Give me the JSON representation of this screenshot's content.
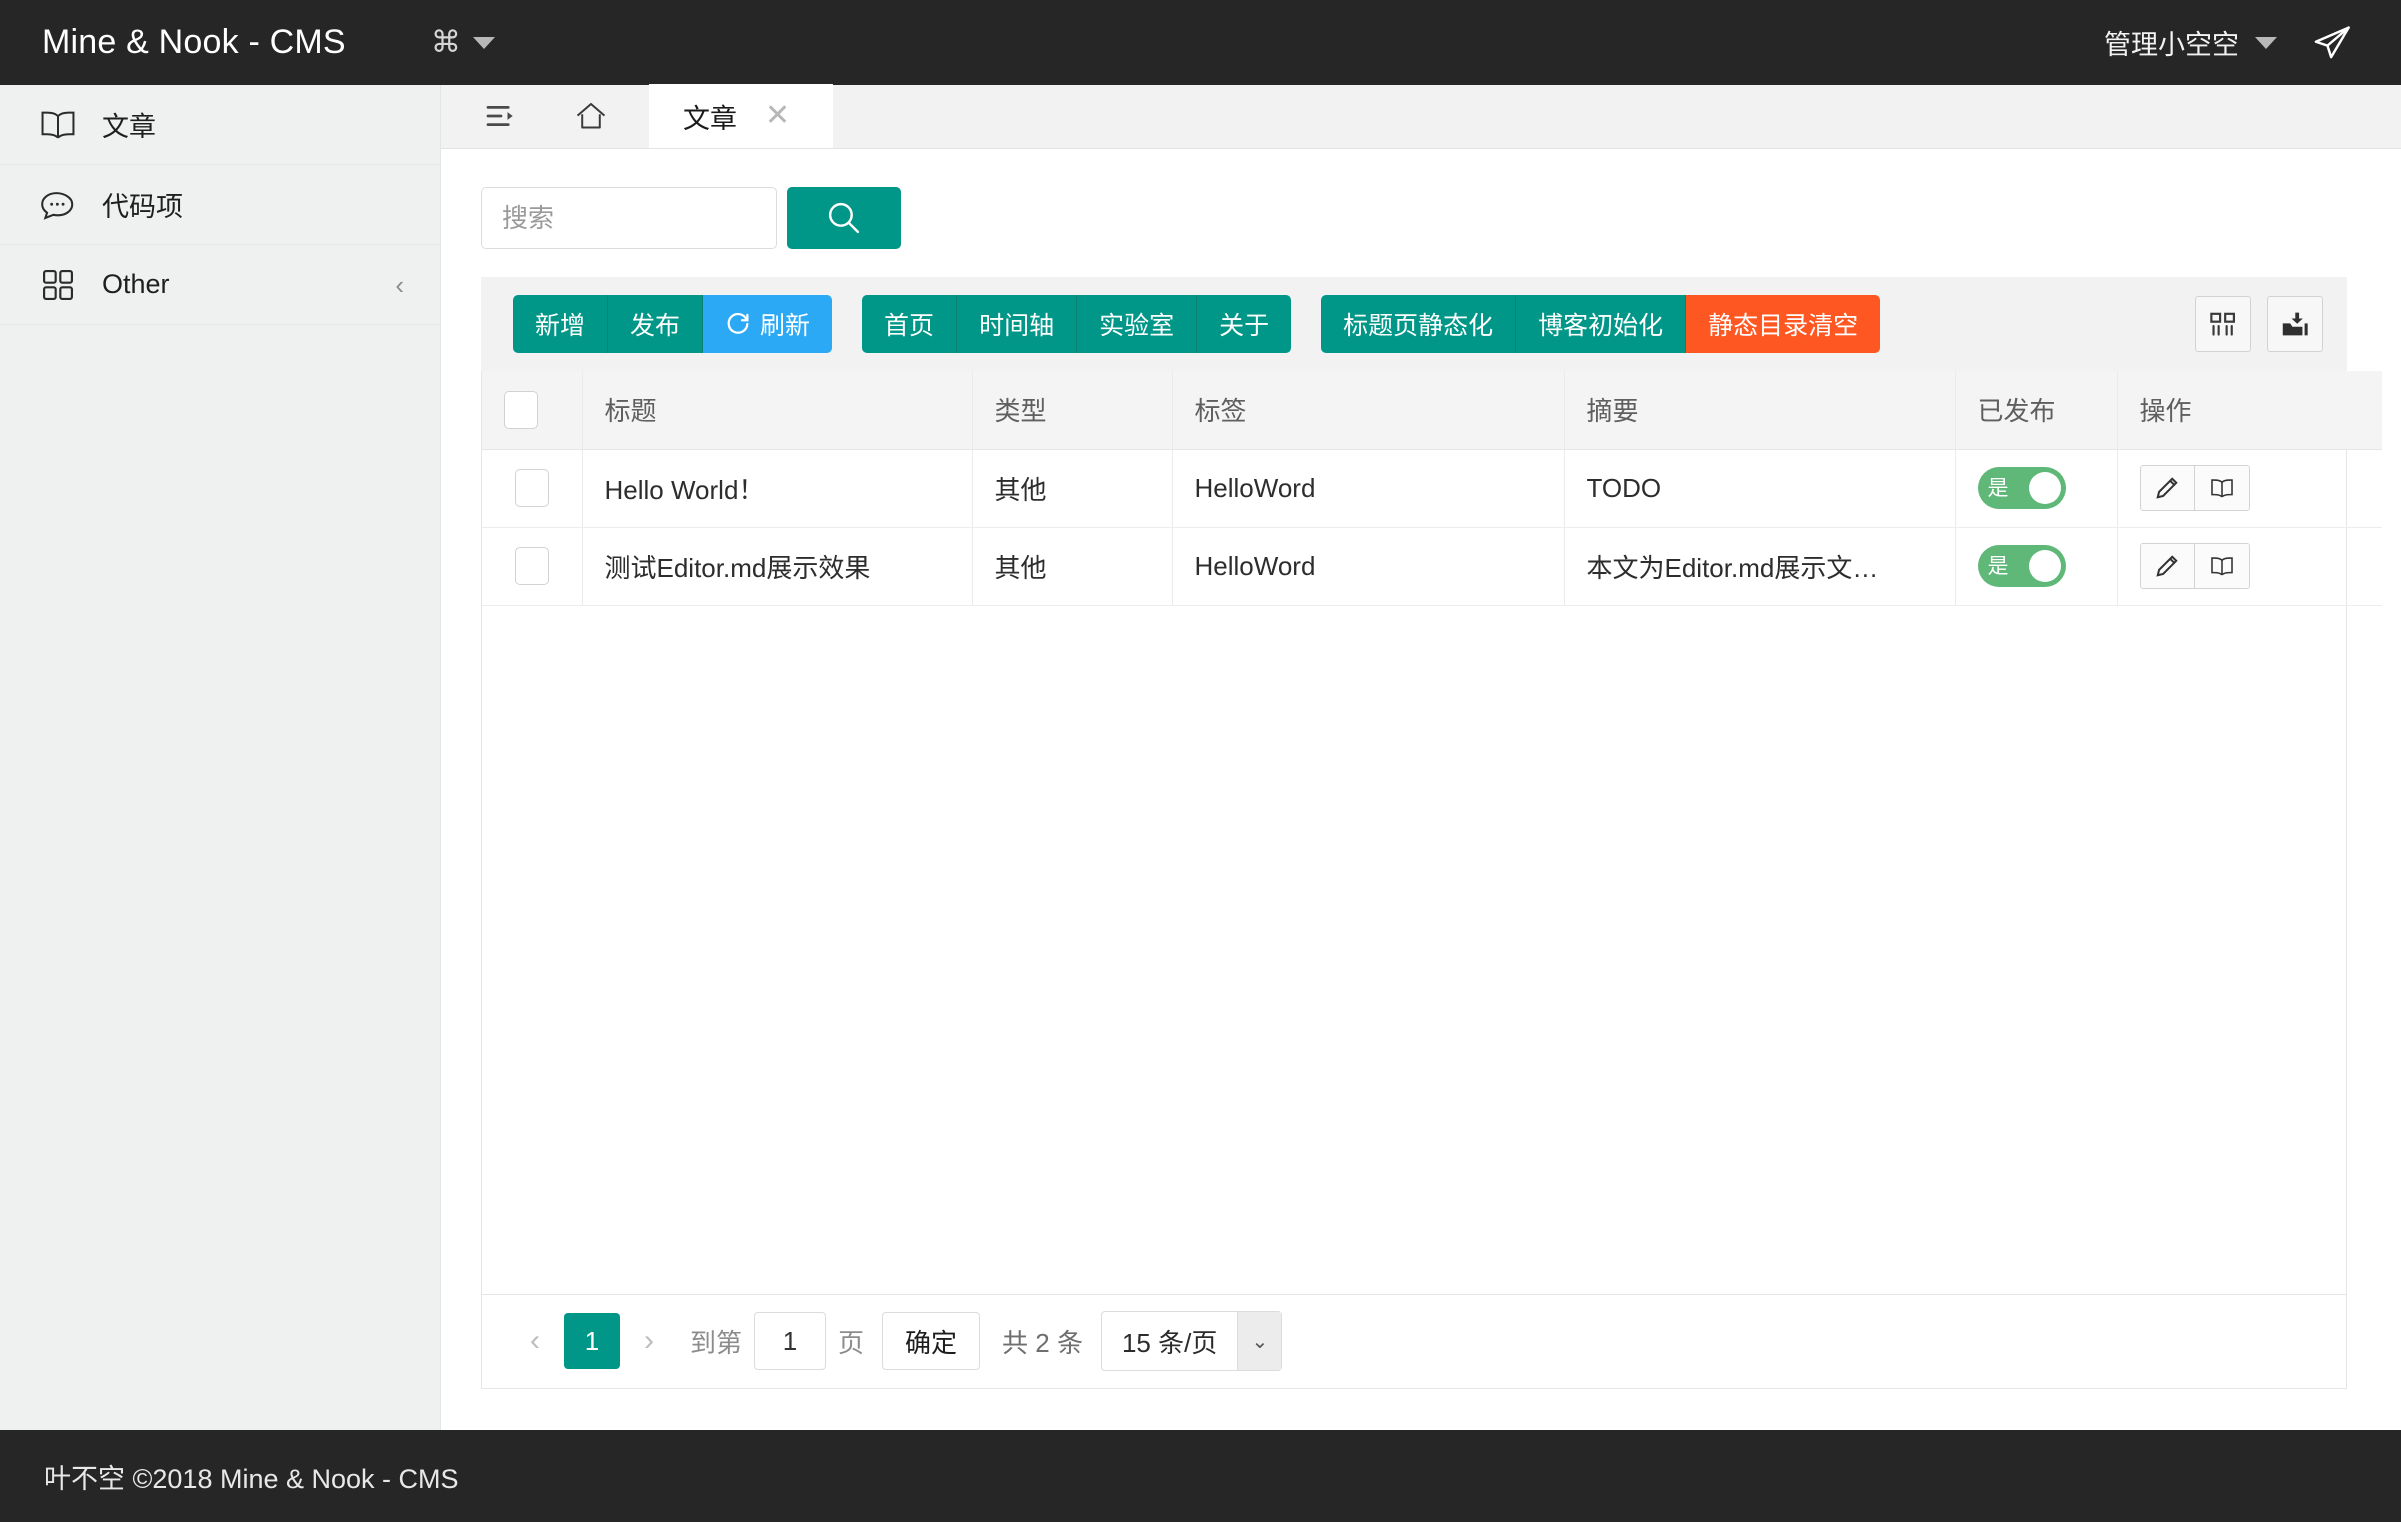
{
  "header": {
    "brand": "Mine & Nook - CMS",
    "menu_glyph": "⌘",
    "user_name": "管理小空空",
    "caret_icon": "chevron-down-icon",
    "send_icon": "paper-plane-icon"
  },
  "sidebar": {
    "items": [
      {
        "label": "文章",
        "icon": "book-icon",
        "arrow": ""
      },
      {
        "label": "代码项",
        "icon": "comment-icon",
        "arrow": ""
      },
      {
        "label": "Other",
        "icon": "grid-icon",
        "arrow": "‹"
      }
    ]
  },
  "tabstrip": {
    "tools": [
      {
        "name": "collapse-menu-icon"
      },
      {
        "name": "home-icon"
      }
    ],
    "tabs": [
      {
        "label": "文章",
        "close": "✕",
        "active": true
      }
    ]
  },
  "search": {
    "value": "",
    "placeholder": "搜索",
    "button_icon": "search-icon"
  },
  "toolbar": {
    "groups": [
      {
        "buttons": [
          {
            "label": "新增",
            "style": "green"
          },
          {
            "label": "发布",
            "style": "green"
          },
          {
            "label": "刷新",
            "style": "blue",
            "icon": "refresh-icon"
          }
        ]
      },
      {
        "buttons": [
          {
            "label": "首页",
            "style": "green"
          },
          {
            "label": "时间轴",
            "style": "green"
          },
          {
            "label": "实验室",
            "style": "green"
          },
          {
            "label": "关于",
            "style": "green"
          }
        ]
      },
      {
        "buttons": [
          {
            "label": "标题页静态化",
            "style": "green"
          },
          {
            "label": "博客初始化",
            "style": "green"
          },
          {
            "label": "静态目录清空",
            "style": "orange"
          }
        ]
      }
    ],
    "icon_buttons": [
      {
        "name": "column-filter-icon"
      },
      {
        "name": "export-icon"
      }
    ]
  },
  "table": {
    "columns": [
      "",
      "标题",
      "类型",
      "标签",
      "摘要",
      "已发布",
      "操作"
    ],
    "rows": [
      {
        "title": "Hello World！",
        "type": "其他",
        "tag": "HelloWord",
        "summary": "TODO",
        "published": "是",
        "actions": [
          "edit-icon",
          "view-icon"
        ]
      },
      {
        "title": "测试Editor.md展示效果",
        "type": "其他",
        "tag": "HelloWord",
        "summary": "本文为Editor.md展示文…",
        "published": "是",
        "actions": [
          "edit-icon",
          "view-icon"
        ]
      }
    ]
  },
  "pagination": {
    "prev_icon": "‹",
    "next_icon": "›",
    "current_page": "1",
    "goto_prefix": "到第",
    "goto_value": "1",
    "goto_suffix": "页",
    "confirm_label": "确定",
    "total_label": "共 2 条",
    "page_size": "15 条/页",
    "select_arrow": "⌄"
  },
  "footer": {
    "text": "叶不空 ©2018 Mine & Nook - CMS"
  },
  "colors": {
    "brand_green": "#009688",
    "accent_blue": "#2ba9f5",
    "accent_orange": "#ff5722",
    "toggle_green": "#5fb878",
    "header_dark": "#262626",
    "sidebar_bg": "#eff0f0"
  }
}
